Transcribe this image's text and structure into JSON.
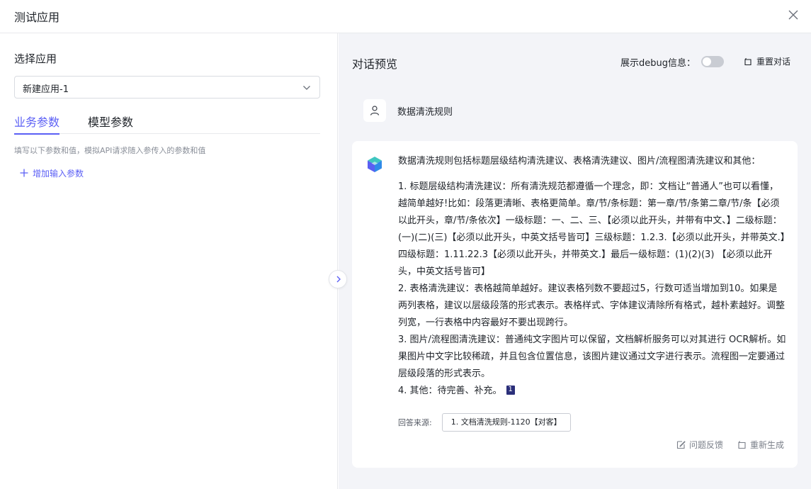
{
  "dialog": {
    "title": "测试应用"
  },
  "left": {
    "select_label": "选择应用",
    "selected_app": "新建应用-1",
    "tabs": [
      {
        "label": "业务参数",
        "active": true
      },
      {
        "label": "模型参数",
        "active": false
      }
    ],
    "hint": "填写以下参数和值，模拟API请求随入参传入的参数和值",
    "add_param": "增加输入参数"
  },
  "right": {
    "title": "对话预览",
    "debug_label": "展示debug信息：",
    "debug_enabled": false,
    "reset_label": "重置对话",
    "user_message": "数据清洗规则",
    "bot": {
      "intro": "数据清洗规则包括标题层级结构清洗建议、表格清洗建议、图片/流程图清洗建议和其他：",
      "items": [
        "1. 标题层级结构清洗建议：所有清洗规范都遵循一个理念，即：文档让“普通人”也可以看懂，越简单越好!比如：段落更清晰、表格更简单。章/节/条标题：第一章/节/条第二章/节/条【必须以此开头，章/节/条依次】一级标题：一、二、三、【必须以此开头，并带有中文、】二级标题：(一)(二)(三)【必须以此开头，中英文括号皆可】三级标题：1.2.3.【必须以此开头，并带英文.】四级标题：1.11.22.3【必须以此开头，并带英文.】最后一级标题：(1)(2)(3) 【必须以此开头，中英文括号皆可】",
        "2. 表格清洗建议：表格越简单越好。建议表格列数不要超过5，行数可适当增加到10。如果是两列表格，建议以层级段落的形式表示。表格样式、字体建议清除所有格式，越朴素越好。调整列宽，一行表格中内容最好不要出现跨行。",
        "3. 图片/流程图清洗建议：普通纯文字图片可以保留，文档解析服务可以对其进行 OCR解析。如果图片中文字比较稀疏，并且包含位置信息，该图片建议通过文字进行表示。流程图一定要通过层级段落的形式表示。",
        "4. 其他：待完善、补充。"
      ],
      "citation": "1",
      "source_label": "回答来源:",
      "source_chip": "1. 文档清洗规则-1120【对客】",
      "feedback_label": "问题反馈",
      "regenerate_label": "重新生成"
    }
  },
  "colors": {
    "accent": "#5b5ff5",
    "right_bg": "#f3f4f8",
    "citation_bg": "#2b2f7a"
  },
  "icons": [
    "close-icon",
    "chevron-down-icon",
    "plus-icon",
    "chevron-right-icon",
    "reset-icon",
    "user-icon",
    "bot-cube-icon",
    "feedback-icon",
    "regenerate-icon"
  ]
}
